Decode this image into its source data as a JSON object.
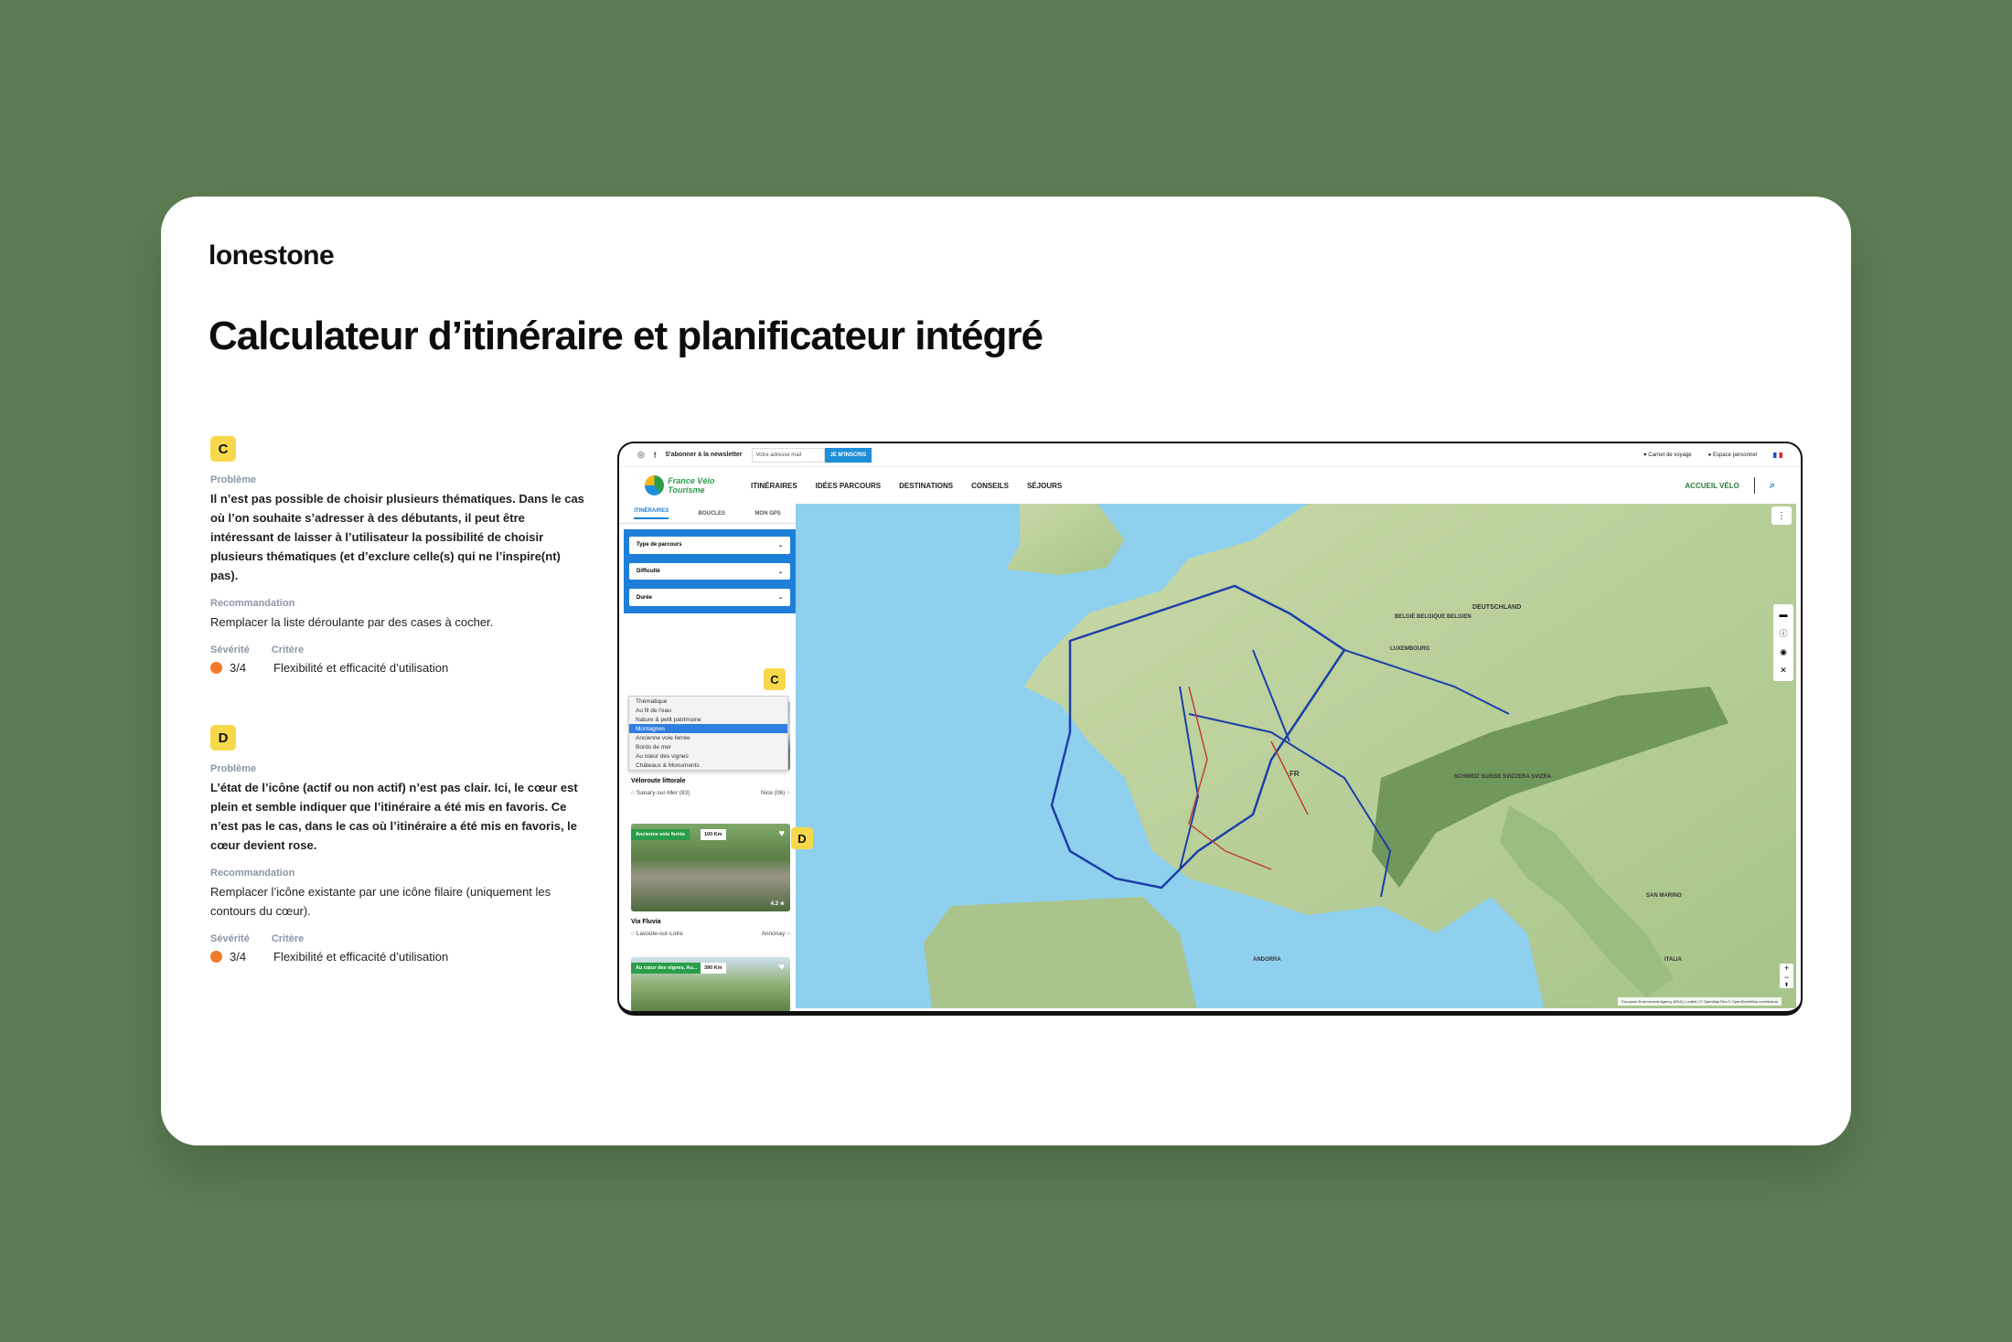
{
  "logo": "lonestone",
  "title": "Calculateur d’itinéraire et planificateur intégré",
  "issues": [
    {
      "badge": "C",
      "problem_label": "Problème",
      "problem": "Il n’est pas possible de choisir plusieurs thématiques. Dans le cas où l’on souhaite s’adresser à des débutants, il peut être intéressant de laisser à l’utilisateur la possibilité de choisir plusieurs thématiques (et d’exclure celle(s) qui ne l’inspire(nt) pas).",
      "reco_label": "Recommandation",
      "reco": "Remplacer la liste déroulante par des cases à cocher.",
      "severity_label": "Sévérité",
      "criterion_label": "Critère",
      "severity": "3/4",
      "criterion": "Flexibilité et efficacité d’utilisation"
    },
    {
      "badge": "D",
      "problem_label": "Problème",
      "problem": "L’état de l’icône (actif ou non actif) n’est pas clair. Ici, le cœur est plein et semble indiquer que l’itinéraire a été mis en favoris. Ce n’est pas le cas, dans le cas où l’itinéraire a été mis en favoris, le cœur devient rose.",
      "reco_label": "Recommandation",
      "reco": "Remplacer l’icône existante par une icône filaire (uniquement les contours du cœur).",
      "severity_label": "Sévérité",
      "criterion_label": "Critère",
      "severity": "3/4",
      "criterion": "Flexibilité et efficacité d’utilisation"
    }
  ],
  "site": {
    "newsletter": "S'abonner à la newsletter",
    "email_placeholder": "Votre adresse mail",
    "subscribe": "JE M'INSCRIS",
    "carnet": "Carnet de voyage",
    "espace": "Espace personnel",
    "logo_text": "France Vélo Tourisme",
    "nav": [
      "ITINÉRAIRES",
      "IDÉES PARCOURS",
      "DESTINATIONS",
      "CONSEILS",
      "SÉJOURS"
    ],
    "accueil": "ACCUEIL VÉLO",
    "tabs": [
      "ITINÉRAIRES",
      "BOUCLES",
      "MON GPS"
    ],
    "filters": [
      "Type de parcours",
      "Difficulté",
      "Durée"
    ],
    "dropdown": [
      "Thématique",
      "Au fil de l'eau",
      "Nature & petit patrimoine",
      "Montagnes",
      "Ancienne voie ferrée",
      "Bords de mer",
      "Au cœur des vignes",
      "Châteaux & Monuments"
    ],
    "routes": [
      {
        "name": "Véloroute littorale",
        "from": "Sanary-sur-Mer (83)",
        "to": "Nice (06)"
      },
      {
        "name": "Via Fluvia",
        "tag": "Ancienne voie ferrée",
        "km": "100 Km",
        "rating": "4.3",
        "from": "Lavoûte-sur-Loire",
        "to": "Annonay"
      },
      {
        "tag": "Au cœur des vignes, Au...",
        "km": "390 Km"
      }
    ],
    "map_labels": [
      "DEUTSCHLAND",
      "BELGIË BELGIQUE BELGIEN",
      "LUXEMBOURG",
      "SCHWEIZ SUISSE SVIZZERA SVIZRA",
      "FR",
      "SAN MARINO",
      "ITALIA",
      "ANDORRA"
    ],
    "attribution": "European Environment Agency (EEA) | Leaflet | © OpenMapTiles © OpenStreetMap contributors"
  }
}
